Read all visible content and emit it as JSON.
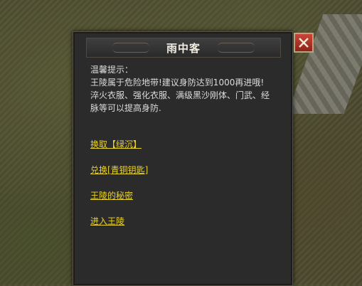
{
  "dialog": {
    "title": "雨中客",
    "tip_lines": [
      "温馨提示：",
      "王陵属于危险地带!建议身防达到1000再进哦!",
      "淬火衣服、强化衣服、满级黑沙刚体、门武、经",
      "脉等可以提高身防."
    ],
    "links": [
      "换取【绿沉】",
      "兑换[青铜钥匙]",
      "王陵的秘密",
      "进入王陵"
    ],
    "close_icon": "close-icon"
  },
  "colors": {
    "panel_bg": "#2b2b2b",
    "link": "#e8d12a",
    "text": "#dcdcdc",
    "close_btn": "#b8372c"
  }
}
